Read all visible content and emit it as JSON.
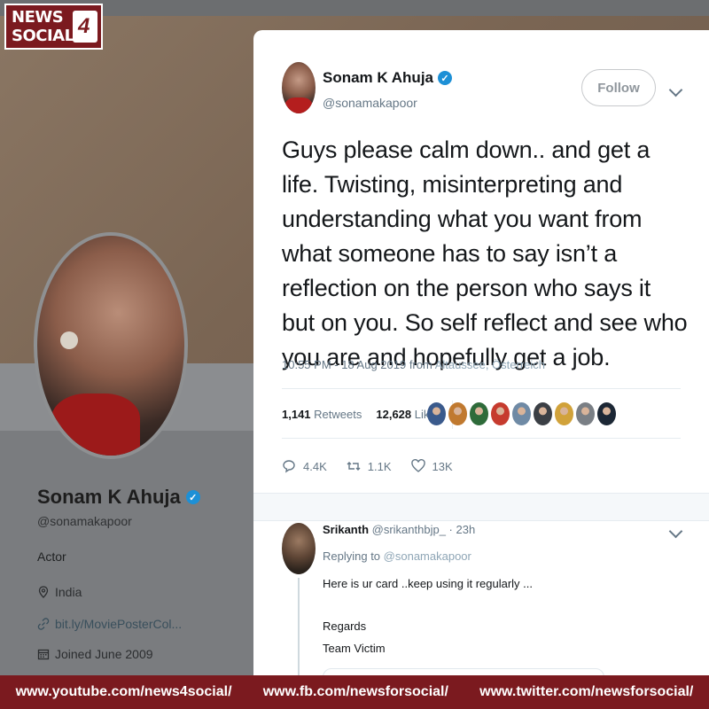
{
  "logo": {
    "line1": "NEWS",
    "line2": "SOCIAL"
  },
  "profile": {
    "name": "Sonam K Ahuja",
    "handle": "@sonamakapoor",
    "bio": "Actor",
    "location": "India",
    "link": "bit.ly/MoviePosterCol...",
    "joined": "Joined June 2009"
  },
  "tweet": {
    "author_name": "Sonam K Ahuja",
    "author_handle": "@sonamakapoor",
    "follow_label": "Follow",
    "text": "Guys please calm down.. and get a life. Twisting, misinterpreting and understanding what you want from what someone has to say isn’t a reflection on the person who says it but on you. So self reflect and see who you are and hopefully get a job.",
    "timestamp": "10:55 PM - 18 Aug 2019 from",
    "place": "Altaussee, Österreich",
    "retweets_count": "1,141",
    "retweets_label": "Retweets",
    "likes_count": "12,628",
    "likes_label": "Likes",
    "replies_action": "4.4K",
    "retweets_action": "1.1K",
    "likes_action": "13K",
    "liker_colors": [
      "#3a5a8c",
      "#c0792f",
      "#2e6b3a",
      "#c63b2e",
      "#6f8aa5",
      "#3b3f45",
      "#d1a23a",
      "#7a7f85",
      "#1c2735"
    ]
  },
  "reply": {
    "name": "Srikanth",
    "handle": "@srikanthbjp_ · 23h",
    "replying_label": "Replying to",
    "replying_to": "@sonamakapoor",
    "line1": "Here is ur card ..keep using it regularly ...",
    "line2": "Regards",
    "line3": "Team Victim"
  },
  "footer": {
    "youtube": "www.youtube.com/news4social/",
    "facebook": "www.fb.com/newsforsocial/",
    "twitter": "www.twitter.com/newsforsocial/"
  },
  "colors": {
    "accent": "#1d90d6",
    "brand": "#7b1a1f"
  }
}
